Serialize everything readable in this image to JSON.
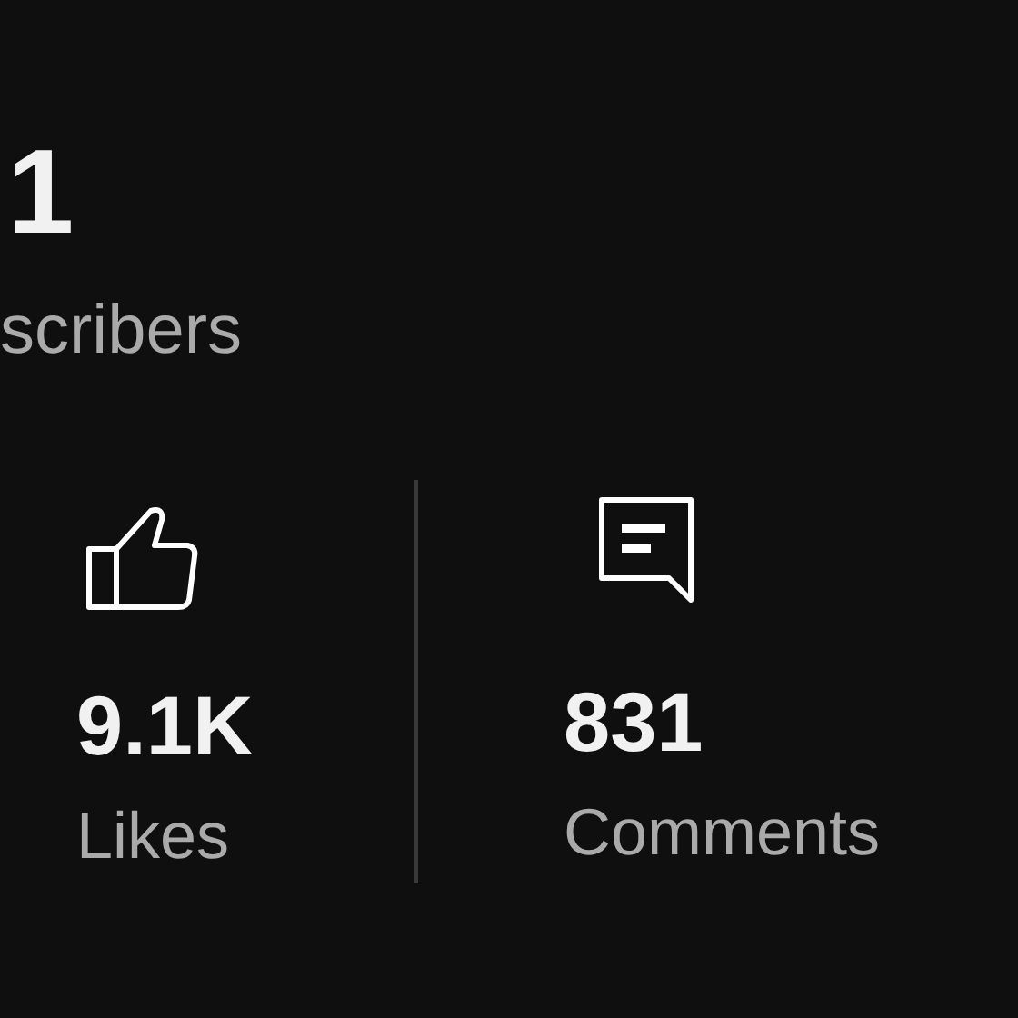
{
  "header": {
    "count": "1",
    "label": "scribers"
  },
  "stats": [
    {
      "kind": "likes",
      "value": "9.1K",
      "label": "Likes"
    },
    {
      "kind": "comments",
      "value": "831",
      "label": "Comments"
    }
  ]
}
